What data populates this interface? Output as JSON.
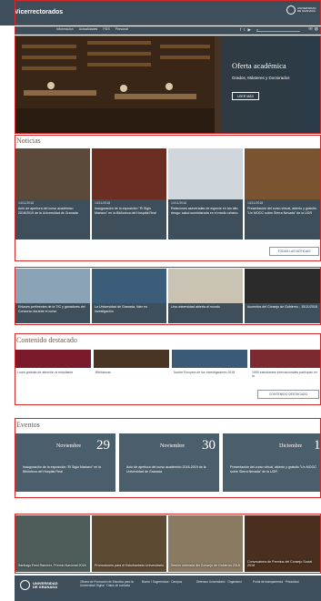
{
  "header": {
    "site_title": "Vicerrectorados",
    "logo_text": "UNIVERSIDAD DE GRANADA"
  },
  "nav": {
    "items": [
      "Información",
      "Actualidades",
      "PDS",
      "Personal"
    ],
    "social": [
      "f",
      "t",
      "▶"
    ]
  },
  "hero": {
    "title": "Oferta académica",
    "subtitle": "Grados, Másteres y Doctorados",
    "button": "LEER MÁS"
  },
  "sections": {
    "news": "Noticias",
    "featured": "Contenido destacado",
    "events": "Eventos"
  },
  "news": [
    {
      "date": "14/11/2018",
      "text": "Acto de apertura del curso académico 2018/2019 de la Universidad de Granada",
      "color": "#5b4a3a"
    },
    {
      "date": "14/11/2018",
      "text": "Inauguración de la exposición \"El Siglo Mariano\" en la Biblioteca del Hospital Real",
      "color": "#6a2e22"
    },
    {
      "date": "14/11/2018",
      "text": "Relaciones aseveradas de especie en tan alto riesgo: salud suministrada en el medio urbano",
      "color": "#cfd6dc"
    },
    {
      "date": "14/11/2018",
      "text": "Presentación del curso virtual, abierto y gratuito \"Un MOOC sobre Sierra Nevada\" de la UGR",
      "color": "#7a5430"
    }
  ],
  "news_button": "TODAS LAS NOTICIAS",
  "strip": [
    {
      "text": "Enlaces pertinentes de la TIC y ganadores del Concurso durante el curso",
      "color": "#8aa3b6"
    },
    {
      "text": "La Universidad de Granada, líder en investigación",
      "color": "#3c5d7a"
    },
    {
      "text": "Una universidad abierta al mundo",
      "color": "#c9c3b4"
    },
    {
      "text": "Acuerdos del Consejo de Gobierno - 15/11/2018",
      "color": "#2b2b2b"
    }
  ],
  "featured": [
    {
      "text": "Línea gratuita de atención al estudiante",
      "color": "#7a1a2a"
    },
    {
      "text": "Bibliotecas",
      "color": "#4a3424"
    },
    {
      "text": "Noche Europea de los Investigadores 2018",
      "color": "#3b5a78"
    },
    {
      "text": "1950 estudiantes internacionales participan en la",
      "color": "#7c2a30"
    }
  ],
  "featured_button": "CONTENIDO DESTACADO",
  "events": [
    {
      "month": "Noviembre",
      "day": "29",
      "text": "Inauguración de la exposición \"El Siglo Mariano\" en la Biblioteca del Hospital Real"
    },
    {
      "month": "Noviembre",
      "day": "30",
      "text": "Acto de apertura del curso académico 2018-2019 de la Universidad de Granada"
    },
    {
      "month": "Diciembre",
      "day": "1",
      "text": "Presentación del curso virtual, abierto y gratuito \"Un MOOC sobre Sierra Nevada\" de la UGR"
    }
  ],
  "bottom": [
    {
      "text": "Santiago Real Ramírez, Premio Nacional 2018",
      "color": "#4e5d5a"
    },
    {
      "text": "Promociones para el Estudiantado Universitario",
      "color": "#5d4a32"
    },
    {
      "text": "Sesión ordinaria del Consejo de Gobierno 2018",
      "color": "#8a7a62"
    },
    {
      "text": "Convocatoria de Premios del Consejo Social 2018",
      "color": "#4a2f1e"
    }
  ],
  "footer": {
    "logo_text": "UNIVERSIDAD DE GRANADA",
    "col1": "Oficina de Promoción de Estudios para la Universidad Digital · Datos de contacto",
    "col2": "Buzón / Sugerencias · Campus",
    "col3": "Defensor Universitario · Organismo",
    "col4": "Portal de transparencia · Privacidad"
  }
}
